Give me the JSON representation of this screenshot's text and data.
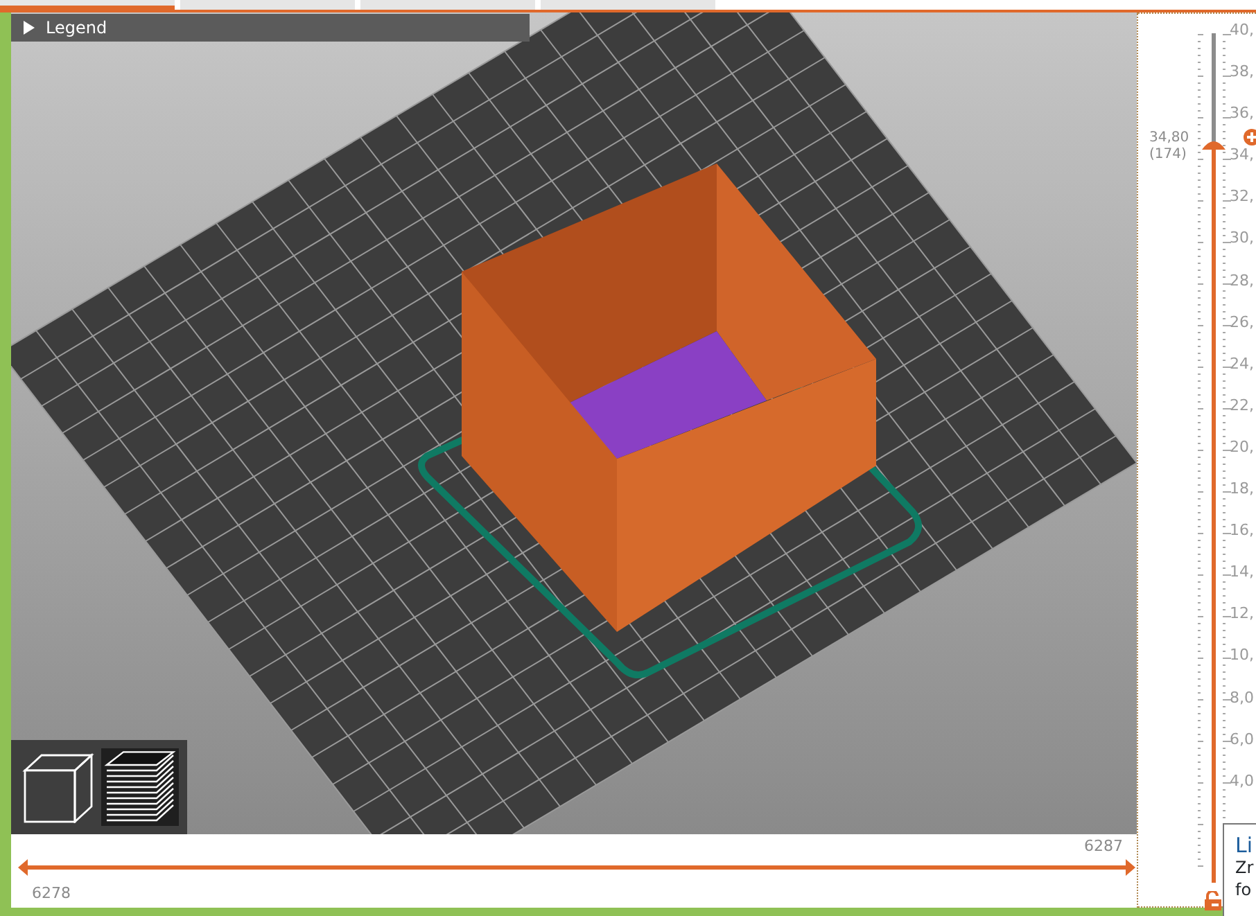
{
  "tabs": [
    {
      "selected": true
    },
    {
      "selected": false
    },
    {
      "selected": false
    },
    {
      "selected": false
    }
  ],
  "legend": {
    "label": "Legend",
    "expanded": false
  },
  "view_buttons": [
    {
      "kind": "model",
      "selected": false
    },
    {
      "kind": "layers",
      "selected": true
    }
  ],
  "horizontal_slider": {
    "left_label": "6278",
    "right_label": "6287"
  },
  "vertical_slider": {
    "ticks": [
      "40,",
      "38,",
      "36,",
      "34,",
      "32,",
      "30,",
      "28,",
      "26,",
      "24,",
      "22,",
      "20,",
      "18,",
      "16,",
      "14,",
      "12,",
      "10,",
      "8,0",
      "6,0",
      "4,0"
    ],
    "thumb_value": "34,80",
    "thumb_layer": "(174)",
    "level": 0.87
  },
  "tooltip": {
    "title": "Li",
    "lines": [
      "Zr",
      "fo"
    ]
  }
}
